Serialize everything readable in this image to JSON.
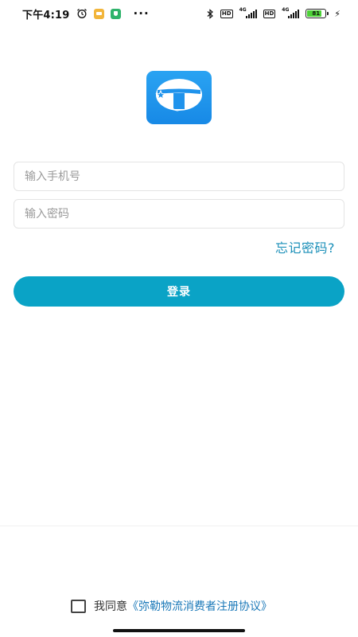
{
  "status_bar": {
    "time": "下午4:19",
    "left_icons": [
      "alarm-clock-icon",
      "message-notification-icon",
      "shield-notification-icon"
    ],
    "more": "···",
    "right_icons": [
      "bluetooth-icon",
      "hd-icon",
      "signal-4g-icon",
      "hd-icon",
      "signal-4g-icon",
      "battery-icon",
      "charging-icon"
    ],
    "hd_label": "HD",
    "network_label": "4G",
    "battery_level": "81",
    "battery_percent": 81,
    "battery_color": "#4cd137"
  },
  "logo": {
    "icon": "app-logo-icon",
    "color": "#1f93ec"
  },
  "form": {
    "phone_placeholder": "输入手机号",
    "password_placeholder": "输入密码",
    "forgot_password": "忘记密码?",
    "login_label": "登录",
    "accent_color": "#0aa3c6"
  },
  "agreement": {
    "prefix": "我同意",
    "link": "《弥勒物流消费者注册协议》",
    "checked": false
  }
}
